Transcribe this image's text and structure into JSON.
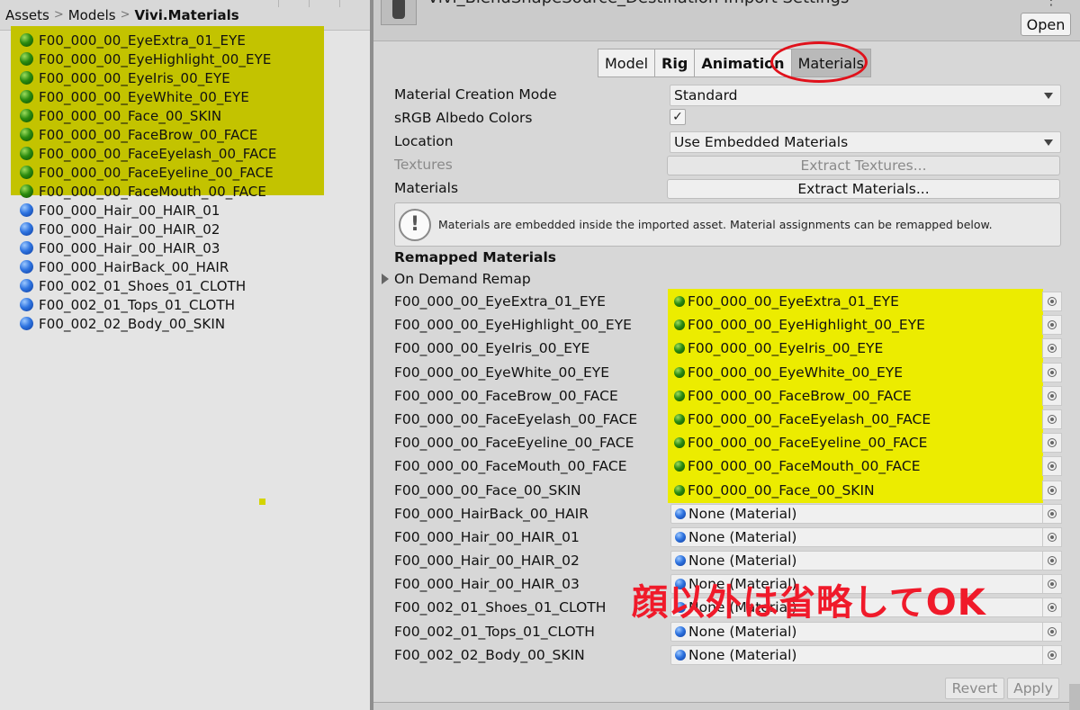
{
  "breadcrumb": {
    "part1": "Assets",
    "part2": "Models",
    "part3": "Vivi.Materials"
  },
  "files": [
    {
      "name": "F00_000_00_EyeExtra_01_EYE",
      "type": "green"
    },
    {
      "name": "F00_000_00_EyeHighlight_00_EYE",
      "type": "green"
    },
    {
      "name": "F00_000_00_EyeIris_00_EYE",
      "type": "green"
    },
    {
      "name": "F00_000_00_EyeWhite_00_EYE",
      "type": "green"
    },
    {
      "name": "F00_000_00_Face_00_SKIN",
      "type": "green"
    },
    {
      "name": "F00_000_00_FaceBrow_00_FACE",
      "type": "green"
    },
    {
      "name": "F00_000_00_FaceEyelash_00_FACE",
      "type": "green"
    },
    {
      "name": "F00_000_00_FaceEyeline_00_FACE",
      "type": "green"
    },
    {
      "name": "F00_000_00_FaceMouth_00_FACE",
      "type": "green"
    },
    {
      "name": "F00_000_Hair_00_HAIR_01",
      "type": "blue"
    },
    {
      "name": "F00_000_Hair_00_HAIR_02",
      "type": "blue"
    },
    {
      "name": "F00_000_Hair_00_HAIR_03",
      "type": "blue"
    },
    {
      "name": "F00_000_HairBack_00_HAIR",
      "type": "blue"
    },
    {
      "name": "F00_002_01_Shoes_01_CLOTH",
      "type": "blue"
    },
    {
      "name": "F00_002_01_Tops_01_CLOTH",
      "type": "blue"
    },
    {
      "name": "F00_002_02_Body_00_SKIN",
      "type": "blue"
    }
  ],
  "inspector": {
    "title": "Vivi_BlendShapeSource_Destination Import Settings",
    "open_label": "Open",
    "tabs": {
      "model": "Model",
      "rig": "Rig",
      "animation": "Animation",
      "materials": "Materials"
    },
    "material_creation_mode": {
      "label": "Material Creation Mode",
      "value": "Standard"
    },
    "srgb": {
      "label": "sRGB Albedo Colors",
      "checked_glyph": "✓"
    },
    "location": {
      "label": "Location",
      "value": "Use Embedded Materials"
    },
    "textures": {
      "label": "Textures",
      "button": "Extract Textures..."
    },
    "materials": {
      "label": "Materials",
      "button": "Extract Materials..."
    },
    "help_icon": "!",
    "help_text": "Materials are embedded inside the imported asset. Material assignments can be remapped below.",
    "remapped_title": "Remapped Materials",
    "on_demand_label": "On Demand Remap",
    "remaps": [
      {
        "label": "F00_000_00_EyeExtra_01_EYE",
        "value": "F00_000_00_EyeExtra_01_EYE",
        "type": "green"
      },
      {
        "label": "F00_000_00_EyeHighlight_00_EYE",
        "value": "F00_000_00_EyeHighlight_00_EYE",
        "type": "green"
      },
      {
        "label": "F00_000_00_EyeIris_00_EYE",
        "value": "F00_000_00_EyeIris_00_EYE",
        "type": "green"
      },
      {
        "label": "F00_000_00_EyeWhite_00_EYE",
        "value": "F00_000_00_EyeWhite_00_EYE",
        "type": "green"
      },
      {
        "label": "F00_000_00_FaceBrow_00_FACE",
        "value": "F00_000_00_FaceBrow_00_FACE",
        "type": "green"
      },
      {
        "label": "F00_000_00_FaceEyelash_00_FACE",
        "value": "F00_000_00_FaceEyelash_00_FACE",
        "type": "green"
      },
      {
        "label": "F00_000_00_FaceEyeline_00_FACE",
        "value": "F00_000_00_FaceEyeline_00_FACE",
        "type": "green"
      },
      {
        "label": "F00_000_00_FaceMouth_00_FACE",
        "value": "F00_000_00_FaceMouth_00_FACE",
        "type": "green"
      },
      {
        "label": "F00_000_00_Face_00_SKIN",
        "value": "F00_000_00_Face_00_SKIN",
        "type": "green"
      },
      {
        "label": "F00_000_HairBack_00_HAIR",
        "value": "None (Material)",
        "type": "blue"
      },
      {
        "label": "F00_000_Hair_00_HAIR_01",
        "value": "None (Material)",
        "type": "blue"
      },
      {
        "label": "F00_000_Hair_00_HAIR_02",
        "value": "None (Material)",
        "type": "blue"
      },
      {
        "label": "F00_000_Hair_00_HAIR_03",
        "value": "None (Material)",
        "type": "blue"
      },
      {
        "label": "F00_002_01_Shoes_01_CLOTH",
        "value": "None (Material)",
        "type": "blue"
      },
      {
        "label": "F00_002_01_Tops_01_CLOTH",
        "value": "None (Material)",
        "type": "blue"
      },
      {
        "label": "F00_002_02_Body_00_SKIN",
        "value": "None (Material)",
        "type": "blue"
      }
    ],
    "revert_label": "Revert",
    "apply_label": "Apply"
  },
  "annotation_text": "顔以外は省略してOK",
  "colors": {
    "highlight_left": "#c3c300",
    "highlight_right": "#ecec00",
    "annotation_red": "#f01a2a"
  }
}
